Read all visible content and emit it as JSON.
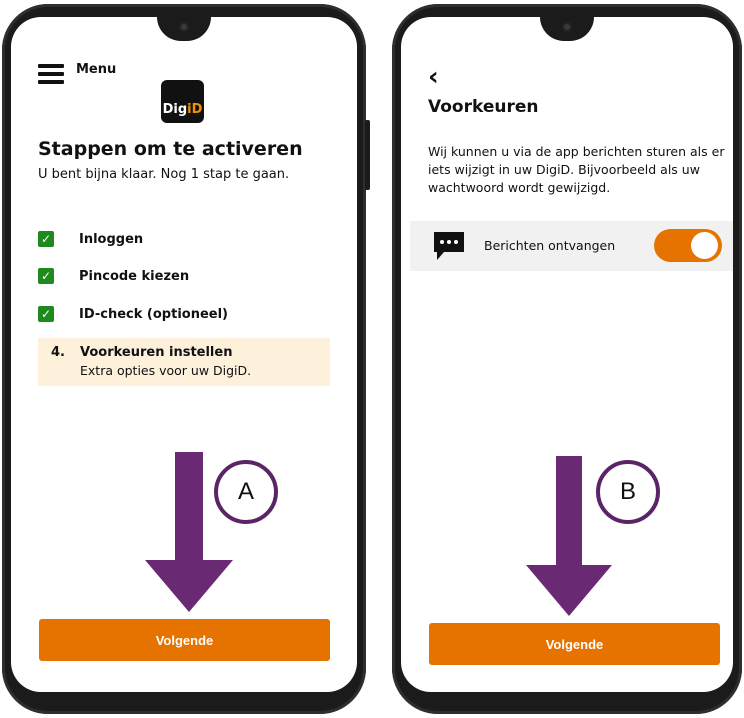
{
  "left_screen": {
    "menu_label": "Menu",
    "logo": {
      "part1": "Dig",
      "part2": "iD"
    },
    "title": "Stappen om te activeren",
    "subtitle": "U bent bijna klaar. Nog 1 stap te gaan.",
    "steps": [
      {
        "label": "Inloggen",
        "done": true
      },
      {
        "label": "Pincode kiezen",
        "done": true
      },
      {
        "label": "ID-check (optioneel)",
        "done": true
      }
    ],
    "current_step": {
      "number": "4.",
      "label": "Voorkeuren instellen",
      "description": "Extra opties voor uw DigiD."
    },
    "button_label": "Volgende",
    "callout": "A"
  },
  "right_screen": {
    "back_icon": "chevron-left-icon",
    "title": "Voorkeuren",
    "body": "Wij kunnen u via de app berichten sturen als er iets wijzigt in uw DigiD. Bijvoorbeeld als uw wachtwoord wordt gewijzigd.",
    "preference": {
      "icon": "chat-bubble-icon",
      "label": "Berichten ontvangen",
      "enabled": true
    },
    "button_label": "Volgende",
    "callout": "B"
  },
  "colors": {
    "accent": "#e67300",
    "check": "#1e8a1e",
    "highlight": "#fdf1dc",
    "arrow": "#6a2a73",
    "logo_accent": "#f39200"
  }
}
